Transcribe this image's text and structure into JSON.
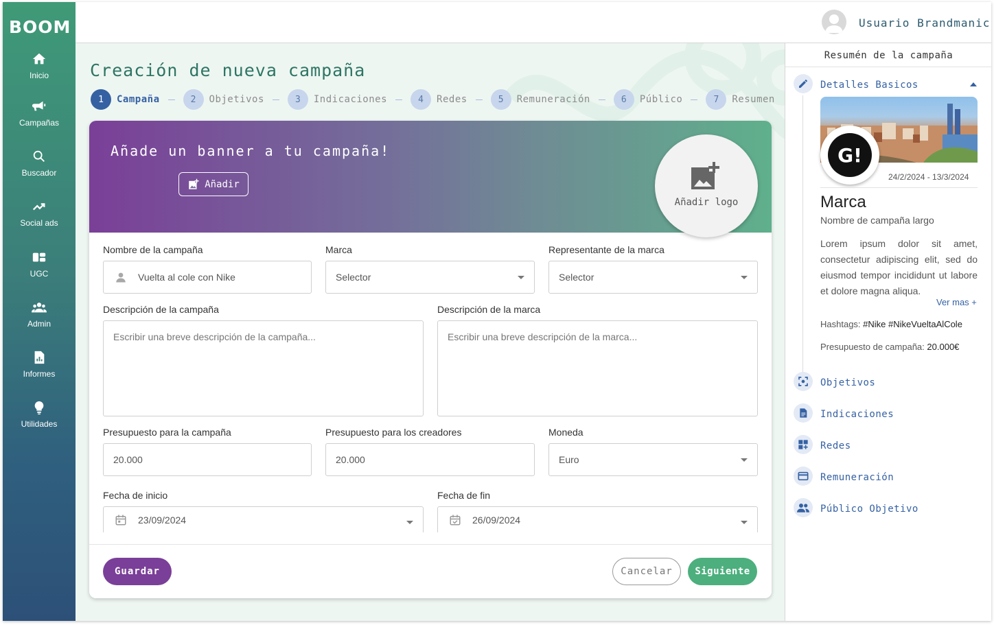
{
  "app": {
    "logo": "BOOM"
  },
  "nav": [
    {
      "label": "Inicio",
      "icon": "home-icon"
    },
    {
      "label": "Campañas",
      "icon": "megaphone-icon"
    },
    {
      "label": "Buscador",
      "icon": "search-icon"
    },
    {
      "label": "Social ads",
      "icon": "trending-up-icon"
    },
    {
      "label": "UGC",
      "icon": "ugc-icon"
    },
    {
      "label": "Admin",
      "icon": "users-icon"
    },
    {
      "label": "Informes",
      "icon": "report-icon"
    },
    {
      "label": "Utilidades",
      "icon": "lightbulb-icon"
    }
  ],
  "header": {
    "username": "Usuario Brandmanic"
  },
  "page": {
    "title": "Creación de nueva campaña"
  },
  "steps": [
    {
      "num": "1",
      "label": "Campaña"
    },
    {
      "num": "2",
      "label": "Objetivos"
    },
    {
      "num": "3",
      "label": "Indicaciones"
    },
    {
      "num": "4",
      "label": "Redes"
    },
    {
      "num": "5",
      "label": "Remuneración"
    },
    {
      "num": "6",
      "label": "Público"
    },
    {
      "num": "7",
      "label": "Resumen"
    }
  ],
  "banner": {
    "title": "Añade un banner a tu campaña!",
    "add_button": "Añadir",
    "logo_label": "Añadir logo"
  },
  "form": {
    "campaign_name_label": "Nombre de la campaña",
    "campaign_name_value": "Vuelta al cole con Nike",
    "brand_label": "Marca",
    "brand_value": "Selector",
    "rep_label": "Representante de la marca",
    "rep_value": "Selector",
    "campaign_desc_label": "Descripción de la campaña",
    "campaign_desc_placeholder": "Escribir una breve descripción de la campaña...",
    "brand_desc_label": "Descripción de la marca",
    "brand_desc_placeholder": "Escribir una breve descripción de la marca...",
    "budget_label": "Presupuesto para la campaña",
    "budget_value": "20.000",
    "creators_budget_label": "Presupuesto para los creadores",
    "creators_budget_value": "20.000",
    "currency_label": "Moneda",
    "currency_value": "Euro",
    "start_label": "Fecha de inicio",
    "start_value": "23/09/2024",
    "end_label": "Fecha de fin",
    "end_value": "26/09/2024"
  },
  "footer": {
    "save": "Guardar",
    "cancel": "Cancelar",
    "next": "Siguiente"
  },
  "summary": {
    "title": "Resumén de la campaña",
    "basic_details": "Detalles Basicos",
    "logo_text": "G!",
    "dates": "24/2/2024 - 13/3/2024",
    "brand": "Marca",
    "campaign_name": "Nombre de campaña largo",
    "description": "Lorem ipsum dolor sit amet, consectetur adipiscing elit, sed do eiusmod tempor incididunt ut labore et dolore magna aliqua.",
    "see_more": "Ver mas +",
    "hashtags_label": "Hashtags:",
    "hashtags_value": "#Nike #NikeVueltaAlCole",
    "budget_label": "Presupuesto de campaña:",
    "budget_value": "20.000€",
    "sections": [
      {
        "label": "Objetivos",
        "icon": "target-icon"
      },
      {
        "label": "Indicaciones",
        "icon": "document-icon"
      },
      {
        "label": "Redes",
        "icon": "grid-add-icon"
      },
      {
        "label": "Remuneración",
        "icon": "credit-card-icon"
      },
      {
        "label": "Público Objetivo",
        "icon": "people-icon"
      }
    ]
  },
  "colors": {
    "primary": "#3561a3",
    "purple": "#7a3f98",
    "green": "#4caf7d",
    "title": "#2e7563"
  }
}
